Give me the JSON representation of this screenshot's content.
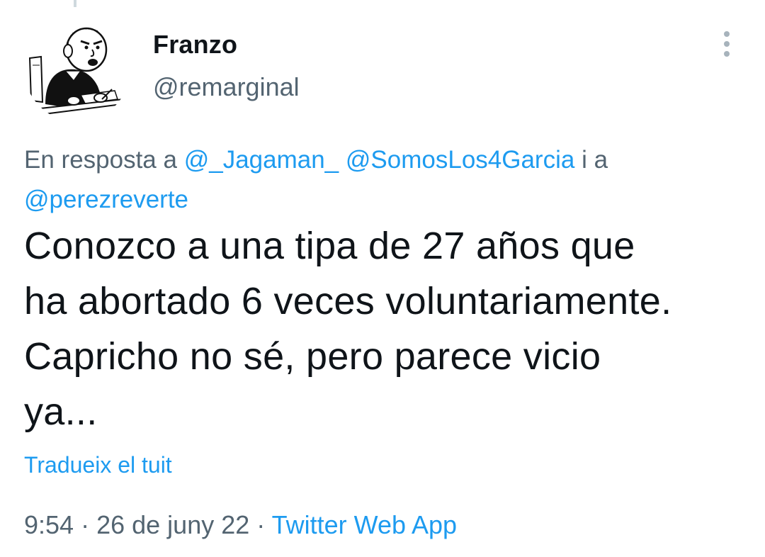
{
  "author": {
    "display_name": "Franzo",
    "handle": "@remarginal",
    "avatar_icon": "cartoon-character-at-desk-avatar"
  },
  "more_icon": "more-options-vertical-icon",
  "reply_context": {
    "prefix": "En resposta a ",
    "mention_1": "@_Jagaman_",
    "separator_1": " ",
    "mention_2": "@SomosLos4Garcia",
    "separator_2": " i a ",
    "mention_3": "@perezreverte"
  },
  "tweet": {
    "lines": [
      "Conozco a una tipa de 27 años que",
      "ha abortado 6 veces voluntariamente.",
      "Capricho no sé, pero parece vicio",
      "ya..."
    ]
  },
  "translate_label": "Tradueix el tuit",
  "meta": {
    "time": "9:54",
    "separator_1": " · ",
    "date": "26 de juny 22",
    "separator_2": " · ",
    "source": "Twitter Web App"
  },
  "colors": {
    "text": "#0f1419",
    "secondary": "#536471",
    "link": "#1d9bf0",
    "background": "#ffffff"
  }
}
